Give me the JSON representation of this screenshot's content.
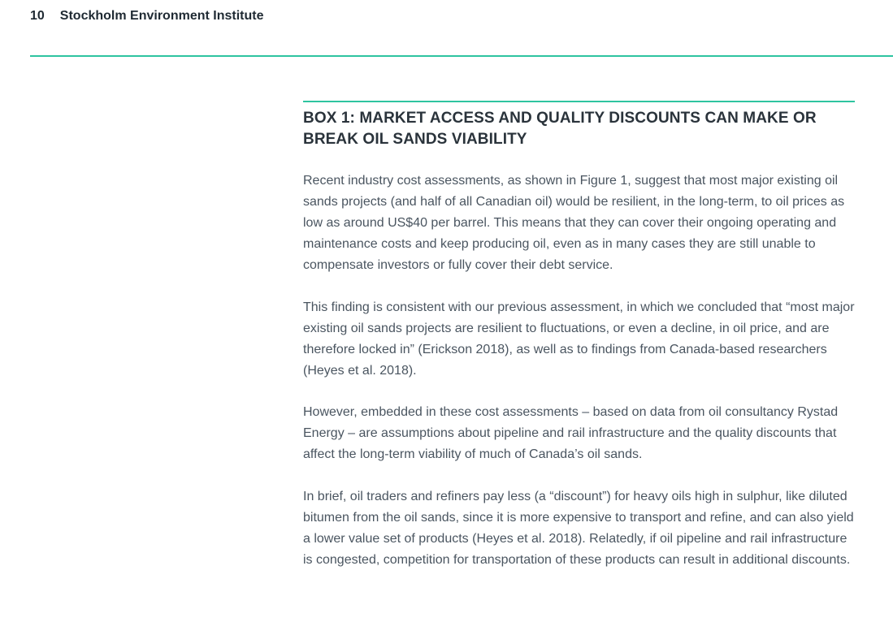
{
  "header": {
    "page_number": "10",
    "publisher": "Stockholm Environment Institute"
  },
  "box": {
    "title": "BOX 1: MARKET ACCESS AND QUALITY DISCOUNTS CAN MAKE OR BREAK OIL SANDS VIABILITY",
    "paragraphs": [
      "Recent industry cost assessments, as shown in Figure 1, suggest that most major existing oil sands projects (and half of all Canadian oil) would be resilient, in the long-term, to oil prices as low as around US$40 per barrel. This means that they can cover their ongoing operating and maintenance costs and keep producing oil, even as in many cases they are still unable to compensate investors or fully cover their debt service.",
      "This finding is consistent with our previous assessment, in which we concluded that “most major existing oil sands projects are resilient to fluctuations, or even a decline, in oil price, and are therefore locked in” (Erickson 2018), as well as to findings from Canada-based researchers (Heyes et al. 2018).",
      "However, embedded in these cost assessments – based on data from oil consultancy Rystad Energy – are assumptions about pipeline and rail infrastructure and the quality discounts that affect the long-term viability of much of Canada’s oil sands.",
      "In brief, oil traders and refiners pay less (a “discount”) for heavy oils high in sulphur, like diluted bitumen from the oil sands, since it is more expensive to transport and refine, and can also yield a lower value set of products (Heyes et al. 2018). Relatedly, if oil pipeline and rail infrastructure is congested, competition for transportation of these products can result in additional discounts."
    ]
  },
  "colors": {
    "accent_rule": "#2ec4a0",
    "heading_text": "#2a333b",
    "body_text": "#4a5560"
  }
}
